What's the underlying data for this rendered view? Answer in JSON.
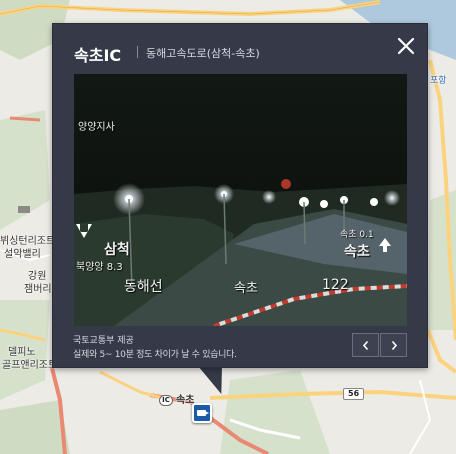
{
  "map": {
    "labels": {
      "sokcho_ic_road": "속초",
      "ic_badge": "IC",
      "resort": "설악밸리",
      "resort_prefix": "뷔싱턴리조트",
      "gangwon": "강원",
      "jambury": "잼버리",
      "delpino": "델피노",
      "golf": "골프앤리조트",
      "pohang": "포항",
      "route_56": "56"
    },
    "colors": {
      "land": "#ecebe5",
      "sea": "#aec9de",
      "forest": "#cfdcc3",
      "highway": "#e98873",
      "road": "#fbd37f"
    }
  },
  "popup": {
    "title": "속초IC",
    "subtitle": "동해고속도로(삼척-속초)",
    "close_icon": "close-icon",
    "camera": {
      "overlay_office": "양양지사",
      "overlay_direction_left": "삼척",
      "overlay_dist_left": "북양양 8.3",
      "overlay_direction_right": "속초",
      "overlay_dist_right": "속초 0.1",
      "overlay_line": "동해선",
      "overlay_sokcho": "속초",
      "overlay_km": "122"
    },
    "provider": "국토교통부 제공",
    "notice": "실제와 5~ 10분 정도 차이가 날 수 있습니다.",
    "prev_icon": "chevron-left-icon",
    "next_icon": "chevron-right-icon"
  }
}
